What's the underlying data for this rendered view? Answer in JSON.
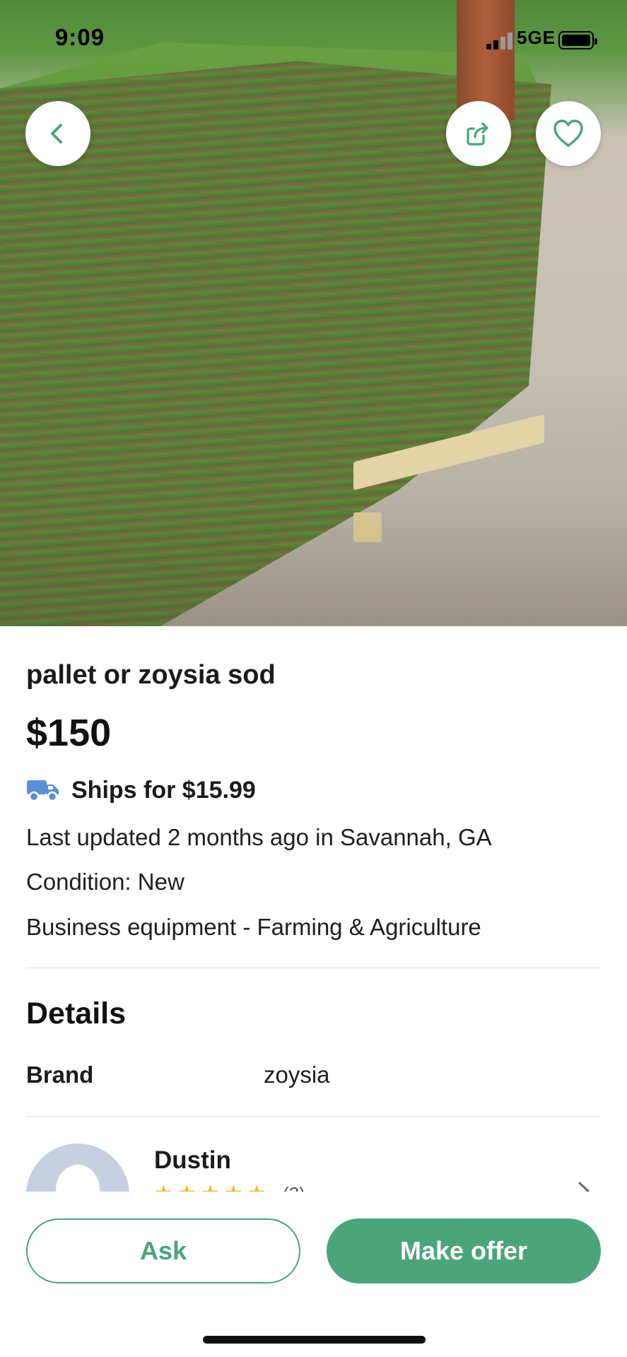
{
  "status_bar": {
    "time": "9:09",
    "network": "5GE"
  },
  "hero": {
    "image_alt": "pallet of zoysia sod",
    "back_icon": "chevron-left-icon",
    "share_icon": "share-icon",
    "favorite_icon": "heart-icon"
  },
  "listing": {
    "title": "pallet or zoysia sod",
    "price": "$150",
    "shipping_icon": "truck-icon",
    "shipping": "Ships for $15.99",
    "updated": "Last updated 2 months ago in Savannah, GA",
    "condition": "Condition: New",
    "category": "Business equipment - Farming & Agriculture"
  },
  "details": {
    "heading": "Details",
    "rows": [
      {
        "label": "Brand",
        "value": "zoysia"
      }
    ]
  },
  "seller": {
    "name": "Dustin",
    "rating": 5,
    "review_count": "(2)"
  },
  "actions": {
    "ask_label": "Ask",
    "offer_label": "Make offer"
  },
  "colors": {
    "accent": "#4aa57a",
    "star": "#f2b92b",
    "truck": "#5b8fd6"
  }
}
